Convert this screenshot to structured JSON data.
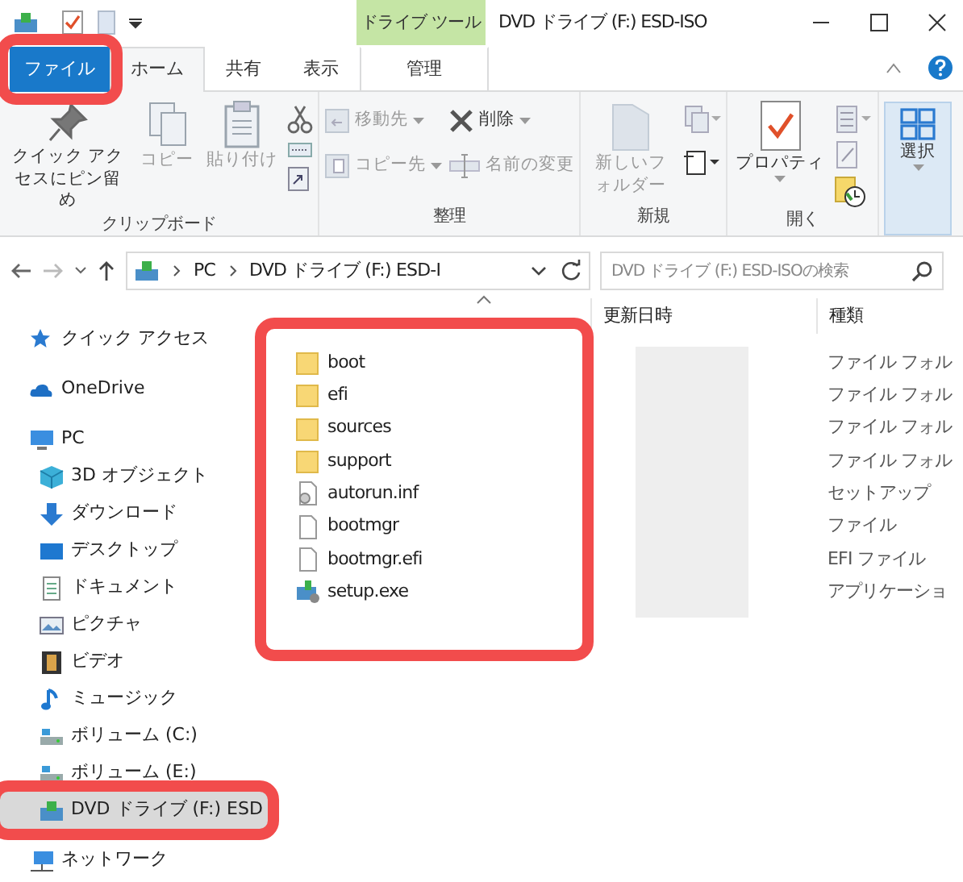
{
  "window": {
    "title": "DVD ドライブ (F:) ESD-ISO",
    "context_tab_group": "ドライブ ツール"
  },
  "tabs": [
    {
      "label": "ファイル",
      "kind": "file",
      "selected": false,
      "highlighted": true
    },
    {
      "label": "ホーム",
      "kind": "tab",
      "selected": true,
      "highlighted": false
    },
    {
      "label": "共有",
      "kind": "tab",
      "selected": false,
      "highlighted": false
    },
    {
      "label": "表示",
      "kind": "tab",
      "selected": false,
      "highlighted": false
    },
    {
      "label": "管理",
      "kind": "context",
      "selected": false,
      "highlighted": false
    }
  ],
  "ribbon_groups": [
    {
      "label": "クリップボード",
      "items": [
        {
          "kind": "pin",
          "label": "クイック アクセスにピン留め",
          "disabled": false
        },
        {
          "kind": "copy",
          "label": "コピー",
          "disabled": true
        },
        {
          "kind": "paste",
          "label": "貼り付け",
          "disabled": true
        },
        {
          "kind": "clip-tools"
        }
      ]
    },
    {
      "label": "整理",
      "items": [
        {
          "kind": "organize",
          "rows": [
            {
              "kind": "move",
              "label": "移動先",
              "disabled": true
            },
            {
              "kind": "copyto",
              "label": "コピー先",
              "disabled": true
            }
          ]
        },
        {
          "kind": "organize",
          "rows": [
            {
              "kind": "delete",
              "label": "削除",
              "disabled": false
            },
            {
              "kind": "rename",
              "label": "名前の変更",
              "disabled": true
            }
          ]
        }
      ]
    },
    {
      "label": "新規",
      "items": [
        {
          "kind": "newfolder",
          "label": "新しいフォルダー",
          "disabled": true
        },
        {
          "kind": "new-tools"
        }
      ]
    },
    {
      "label": "開く",
      "items": [
        {
          "kind": "properties",
          "label": "プロパティ",
          "disabled": false
        },
        {
          "kind": "open-tools"
        }
      ]
    },
    {
      "items": [
        {
          "kind": "select",
          "label": "選択",
          "disabled": false
        }
      ]
    }
  ],
  "address_bar": {
    "path": [
      "PC",
      "DVD ドライブ (F:) ESD-I"
    ]
  },
  "search": {
    "placeholder": "DVD ドライブ (F:) ESD-ISOの検索"
  },
  "sidebar": {
    "items": [
      {
        "label": "クイック アクセス",
        "kind": "star",
        "selected": false,
        "highlighted": false
      },
      {
        "label": "OneDrive",
        "kind": "cloud",
        "selected": false,
        "highlighted": false
      },
      {
        "label": "PC",
        "kind": "pc",
        "selected": false,
        "highlighted": false,
        "children": [
          {
            "label": "3D オブジェクト",
            "kind": "cube",
            "selected": false,
            "highlighted": false
          },
          {
            "label": "ダウンロード",
            "kind": "download",
            "selected": false,
            "highlighted": false
          },
          {
            "label": "デスクトップ",
            "kind": "desktop",
            "selected": false,
            "highlighted": false
          },
          {
            "label": "ドキュメント",
            "kind": "document",
            "selected": false,
            "highlighted": false
          },
          {
            "label": "ピクチャ",
            "kind": "pictures",
            "selected": false,
            "highlighted": false
          },
          {
            "label": "ビデオ",
            "kind": "video",
            "selected": false,
            "highlighted": false
          },
          {
            "label": "ミュージック",
            "kind": "music",
            "selected": false,
            "highlighted": false
          },
          {
            "label": "ボリューム (C:)",
            "kind": "drive",
            "selected": false,
            "highlighted": false
          },
          {
            "label": "ボリューム (E:)",
            "kind": "drive",
            "selected": false,
            "highlighted": false
          },
          {
            "label": "DVD ドライブ (F:) ESD",
            "kind": "dvd",
            "selected": true,
            "highlighted": true
          }
        ]
      },
      {
        "label": "ネットワーク",
        "kind": "network",
        "selected": false,
        "highlighted": false
      }
    ]
  },
  "file_list": {
    "highlighted": true,
    "columns": [
      "更新日時",
      "種類"
    ],
    "rows": [
      {
        "name": "boot",
        "kind": "folder",
        "type": "ファイル フォル"
      },
      {
        "name": "efi",
        "kind": "folder",
        "type": "ファイル フォル"
      },
      {
        "name": "sources",
        "kind": "folder",
        "type": "ファイル フォル"
      },
      {
        "name": "support",
        "kind": "folder",
        "type": "ファイル フォル"
      },
      {
        "name": "autorun.inf",
        "kind": "settings",
        "type": "セットアップ"
      },
      {
        "name": "bootmgr",
        "kind": "file",
        "type": "ファイル"
      },
      {
        "name": "bootmgr.efi",
        "kind": "file",
        "type": "EFI ファイル"
      },
      {
        "name": "setup.exe",
        "kind": "app",
        "type": "アプリケーショ"
      }
    ]
  }
}
